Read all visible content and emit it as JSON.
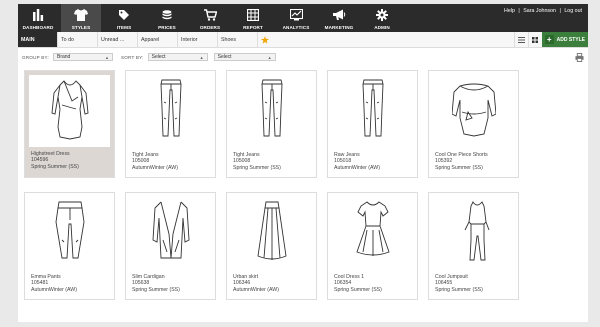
{
  "nav": {
    "items": [
      {
        "label": "DASHBOARD",
        "icon": "bar-chart-icon"
      },
      {
        "label": "STYLES",
        "icon": "shirt-icon",
        "active": true
      },
      {
        "label": "ITEMS",
        "icon": "tag-icon"
      },
      {
        "label": "PRICES",
        "icon": "coins-icon"
      },
      {
        "label": "ORDERS",
        "icon": "cart-icon"
      },
      {
        "label": "REPORT",
        "icon": "grid-report-icon"
      },
      {
        "label": "ANALYTICS",
        "icon": "analytics-icon"
      },
      {
        "label": "MARKETING",
        "icon": "megaphone-icon"
      },
      {
        "label": "ADMIN",
        "icon": "gear-icon"
      }
    ],
    "help": "Help",
    "user": "Sara Johnson",
    "logout": "Log out",
    "sep": "|"
  },
  "tabs": {
    "items": [
      "MAIN",
      "To do",
      "Unread ...",
      "Apparel",
      "Interior",
      "Shoes"
    ],
    "add_style": "ADD STYLE"
  },
  "filters": {
    "group_by_label": "GROUP BY:",
    "group_by_value": "Brand",
    "sort_by_label": "SORT BY:",
    "sort_by_value": "Select",
    "third_value": "Select"
  },
  "products": [
    {
      "name": "Highstreet Dress",
      "id": "104596",
      "season": "Spring Summer (SS)",
      "type": "dress",
      "selected": true
    },
    {
      "name": "Tight Jeans",
      "id": "105008",
      "season": "AutumnWinter (AW)",
      "type": "jeans"
    },
    {
      "name": "Tight Jeans",
      "id": "105008",
      "season": "Spring Summer (SS)",
      "type": "jeans"
    },
    {
      "name": "Raw Jeans",
      "id": "105018",
      "season": "AutumnWinter (AW)",
      "type": "jeans"
    },
    {
      "name": "Cool One Piece Shorts",
      "id": "105392",
      "season": "Spring Summer (SS)",
      "type": "top"
    },
    {
      "name": "Emma Pants",
      "id": "105481",
      "season": "AutumnWinter (AW)",
      "type": "pants"
    },
    {
      "name": "Slim Cardigan",
      "id": "105638",
      "season": "Spring Summer (SS)",
      "type": "cardigan"
    },
    {
      "name": "Urban skirt",
      "id": "106346",
      "season": "AutumnWinter (AW)",
      "type": "skirt"
    },
    {
      "name": "Cool Dress 1",
      "id": "106354",
      "season": "Spring Summer (SS)",
      "type": "flare-dress"
    },
    {
      "name": "Cool Jumpsuit",
      "id": "106455",
      "season": "Spring Summer (SS)",
      "type": "jumpsuit"
    }
  ],
  "colors": {
    "nav_bg": "#2b2b2b",
    "accent_green": "#3c7f3c",
    "star": "#f0a500"
  }
}
